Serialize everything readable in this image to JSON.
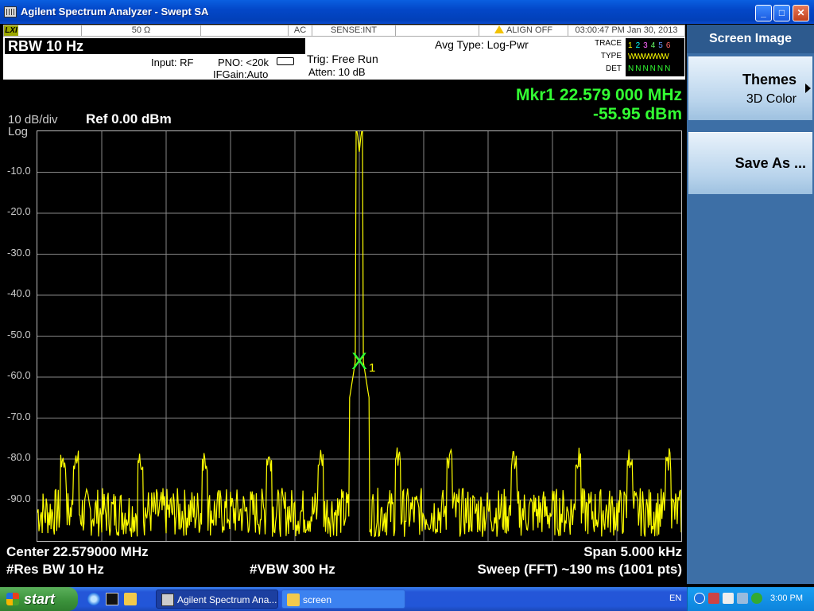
{
  "window": {
    "title": "Agilent Spectrum Analyzer - Swept SA"
  },
  "status_bar": {
    "lxi": "LXI",
    "impedance": "50 Ω",
    "coupling": "AC",
    "sense": "SENSE:INT",
    "align": "ALIGN OFF",
    "datetime": "03:00:47 PM Jan 30, 2013"
  },
  "settings": {
    "rbw": "RBW  10 Hz",
    "input": "Input: RF",
    "pno": "PNO: <20k",
    "ifgain": "IFGain:Auto",
    "trig": "Trig: Free Run",
    "atten": "Atten: 10 dB",
    "avg_type": "Avg Type: Log-Pwr",
    "trace_label": "TRACE",
    "type_label": "TYPE",
    "det_label": "DET",
    "trace_nums": [
      "1",
      "2",
      "3",
      "4",
      "5",
      "6"
    ],
    "trace_colors": [
      "#ffff00",
      "#00ffff",
      "#ff66ff",
      "#66ff66",
      "#6699ff",
      "#ff6666"
    ],
    "type_row": "WWWWWW",
    "det_row": "NNNNNN"
  },
  "display": {
    "scale": "10 dB/div",
    "scale_type": "Log",
    "ref_level": "Ref 0.00 dBm",
    "marker_freq": "Mkr1 22.579 000 MHz",
    "marker_amp": "-55.95 dBm",
    "marker_label": "X",
    "marker_index": "1",
    "center": "Center 22.579000 MHz",
    "span": "Span 5.000 kHz",
    "res_bw": "#Res BW 10 Hz",
    "vbw": "#VBW 300 Hz",
    "sweep": "Sweep (FFT)  ~190 ms (1001 pts)",
    "y_ticks": [
      "-10.0",
      "-20.0",
      "-30.0",
      "-40.0",
      "-50.0",
      "-60.0",
      "-70.0",
      "-80.0",
      "-90.0"
    ]
  },
  "chart_data": {
    "type": "line",
    "xlabel": "",
    "ylabel": "",
    "x_range": [
      22.5765,
      22.5815
    ],
    "ylim": [
      -100,
      0
    ],
    "grid": true,
    "series": [
      {
        "color": "#ffff00",
        "peak_x": 22.579,
        "peak_y": -5.0,
        "marker": {
          "x": 22.579,
          "y": -55.95
        },
        "noise_floor": -93
      }
    ]
  },
  "softkeys": {
    "title": "Screen Image",
    "themes": "Themes",
    "themes_value": "3D Color",
    "save_as": "Save As ..."
  },
  "taskbar": {
    "start": "start",
    "task1": "Agilent Spectrum Ana...",
    "task2": "screen",
    "lang": "EN",
    "clock": "3:00 PM"
  }
}
